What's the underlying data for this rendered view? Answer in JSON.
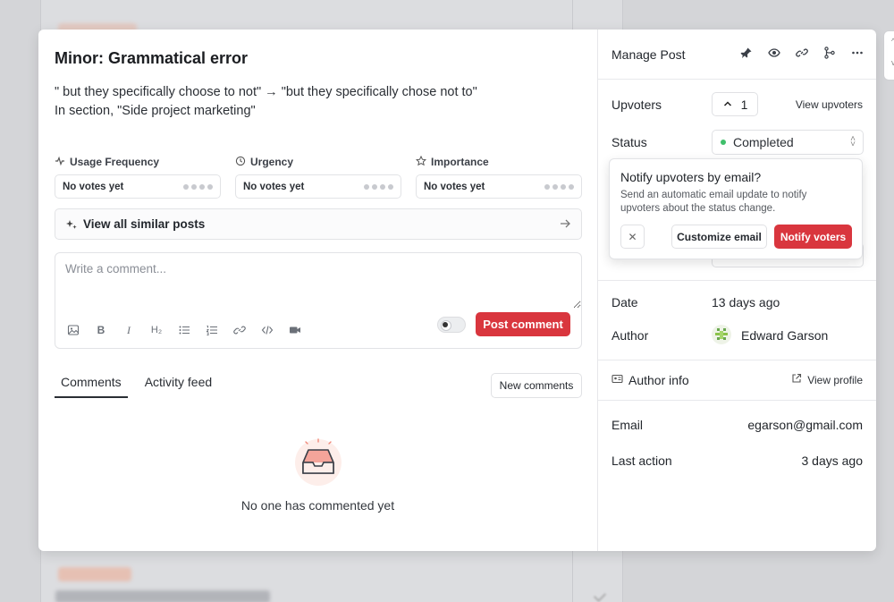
{
  "post": {
    "title": "Minor: Grammatical error",
    "body_line1": "\" but they specifically choose to not\" → \"but they specifically chose not to\"",
    "body_line2": "In section, \"Side project marketing\""
  },
  "metrics": [
    {
      "label": "Usage Frequency",
      "value": "No votes yet",
      "icon": "activity-icon"
    },
    {
      "label": "Urgency",
      "value": "No votes yet",
      "icon": "clock-icon"
    },
    {
      "label": "Importance",
      "value": "No votes yet",
      "icon": "star-icon"
    }
  ],
  "similar": {
    "label": "View all similar posts"
  },
  "comment": {
    "placeholder": "Write a comment...",
    "post_label": "Post comment"
  },
  "tabs": [
    {
      "label": "Comments",
      "active": true
    },
    {
      "label": "Activity feed",
      "active": false
    }
  ],
  "new_comments_label": "New comments",
  "empty_text": "No one has commented yet",
  "sidebar": {
    "header": "Manage Post",
    "upvoters_label": "Upvoters",
    "upvote_count": "1",
    "view_upvoters": "View upvoters",
    "status_label": "Status",
    "status_value": "Completed",
    "date_label": "Date",
    "date_value": "13 days ago",
    "author_label": "Author",
    "author_value": "Edward Garson",
    "author_info_label": "Author info",
    "view_profile": "View profile",
    "email_label": "Email",
    "email_value": "egarson@gmail.com",
    "last_action_label": "Last action",
    "last_action_value": "3 days ago"
  },
  "popover": {
    "title": "Notify upvoters by email?",
    "description": "Send an automatic email update to notify upvoters about the status change.",
    "customize_label": "Customize email",
    "notify_label": "Notify voters"
  },
  "colors": {
    "accent": "#d9363e",
    "status_completed": "#3fbf6b"
  }
}
